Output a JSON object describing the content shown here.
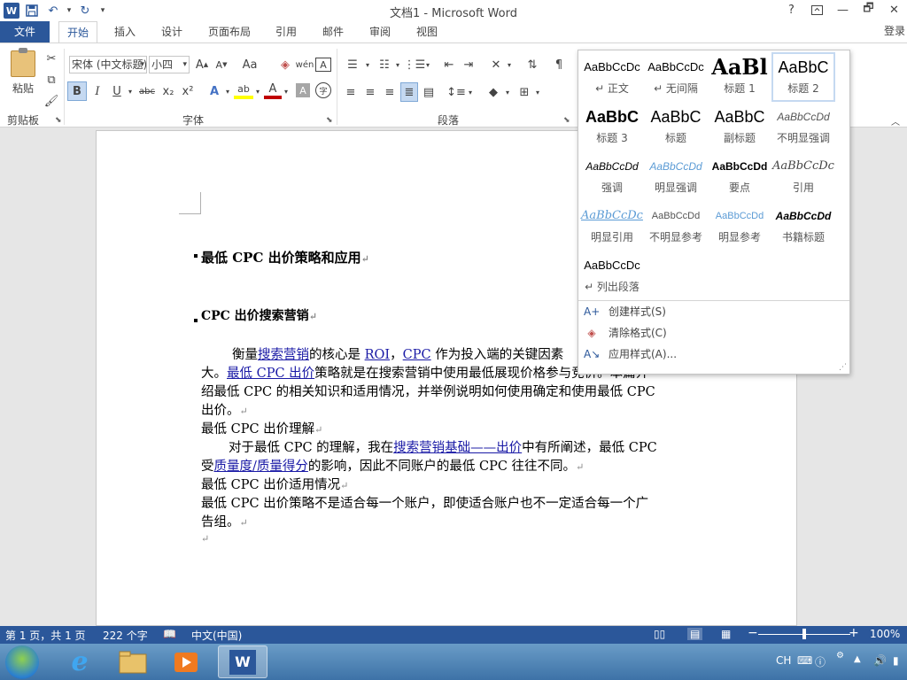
{
  "window": {
    "title": "文档1 - Microsoft Word",
    "help": "?",
    "ribbon_display_icon": "ribbon-display-options-icon",
    "minimize": "—",
    "restore": "🗗",
    "close": "✕"
  },
  "quick_access": {
    "app_icon": "W",
    "save": "💾",
    "undo": "↶",
    "undo_dropdown": "▾",
    "redo": "↻",
    "customize": "▾"
  },
  "tabs": [
    {
      "label": "文件"
    },
    {
      "label": "开始"
    },
    {
      "label": "插入"
    },
    {
      "label": "设计"
    },
    {
      "label": "页面布局"
    },
    {
      "label": "引用"
    },
    {
      "label": "邮件"
    },
    {
      "label": "审阅"
    },
    {
      "label": "视图"
    }
  ],
  "signin": "登录",
  "ribbon": {
    "clipboard": {
      "paste_label": "粘贴",
      "group_label": "剪贴板"
    },
    "font": {
      "font_name": "宋体 (中文标题)",
      "font_size": "小四",
      "grow": "A^",
      "shrink": "Aˇ",
      "change_case": "Aa",
      "clear": "✐",
      "phonetic": "wén",
      "border": "A",
      "bold": "B",
      "italic": "I",
      "underline": "U",
      "strike": "abc",
      "subscript": "x₂",
      "superscript": "x²",
      "effects": "A",
      "highlight": "ab",
      "font_color": "A",
      "shading": "A",
      "enclose": "字",
      "group_label": "字体"
    },
    "paragraph": {
      "group_label": "段落"
    }
  },
  "document": {
    "heading1": "最低 CPC 出价策略和应用",
    "heading2": "CPC 出价搜索营销",
    "p1_a": "衡量",
    "p1_link1": "搜索营销",
    "p1_b": "的核心是 ",
    "p1_link2": "ROI",
    "p1_c": "，",
    "p1_link3": "CPC",
    "p1_d": " 作为投入端的关键因素",
    "p1_line2_a": "大。",
    "p1_line2_link": "最低 CPC 出价",
    "p1_line2_b": "策略就是在搜索营销中使用最低展现价格参与竞价。本篇介",
    "p1_line3": "绍最低 CPC 的相关知识和适用情况，并举例说明如何使用确定和使用最低 CPC",
    "p1_line4": "出价。",
    "sub1": "最低 CPC 出价理解",
    "p2_a": "对于最低 CPC 的理解，我在",
    "p2_link": "搜索营销基础——出价",
    "p2_b": "中有所阐述，最低 CPC",
    "p2_line2_a": "受",
    "p2_line2_link": "质量度/质量得分",
    "p2_line2_b": "的影响，因此不同账户的最低 CPC 往往不同。",
    "sub2": "最低 CPC 出价适用情况",
    "p3_line1": "最低 CPC 出价策略不是适合每一个账户，即使适合账户也不一定适合每一个广",
    "p3_line2": "告组。",
    "para_mark": "↵"
  },
  "styles_gallery": {
    "items": [
      {
        "sample": "AaBbCcDc",
        "name": "↵ 正文"
      },
      {
        "sample": "AaBbCcDc",
        "name": "↵ 无间隔"
      },
      {
        "sample": "AaBl",
        "name": "标题 1"
      },
      {
        "sample": "AaBbC",
        "name": "标题 2"
      },
      {
        "sample": "AaBbC",
        "name": "标题 3"
      },
      {
        "sample": "AaBbC",
        "name": "标题"
      },
      {
        "sample": "AaBbC",
        "name": "副标题"
      },
      {
        "sample": "AaBbCcDd",
        "name": "不明显强调"
      },
      {
        "sample": "AaBbCcDd",
        "name": "强调"
      },
      {
        "sample": "AaBbCcDd",
        "name": "明显强调"
      },
      {
        "sample": "AaBbCcDd",
        "name": "要点"
      },
      {
        "sample": "AaBbCcDc",
        "name": "引用"
      },
      {
        "sample": "AaBbCcDc",
        "name": "明显引用"
      },
      {
        "sample": "AaBbCcDd",
        "name": "不明显参考"
      },
      {
        "sample": "AaBbCcDd",
        "name": "明显参考"
      },
      {
        "sample": "AaBbCcDd",
        "name": "书籍标题"
      },
      {
        "sample": "AaBbCcDc",
        "name": "↵ 列出段落"
      }
    ],
    "selected_index": 3,
    "commands": [
      {
        "label": "创建样式(S)",
        "icon": "create-style-icon"
      },
      {
        "label": "清除格式(C)",
        "icon": "clear-formatting-icon"
      },
      {
        "label": "应用样式(A)...",
        "icon": "apply-styles-icon"
      }
    ]
  },
  "status_bar": {
    "page": "第 1 页，共 1 页",
    "words": "222 个字",
    "language": "中文(中国)",
    "zoom_minus": "−",
    "zoom_plus": "+",
    "zoom": "100%",
    "zoom_level": 1.0
  },
  "taskbar": {
    "ime": "CH",
    "word_icon": "W",
    "ie_icon": "e"
  },
  "colors": {
    "accent": "#2b579a",
    "link": "#1a1aa6",
    "heading_sample": "#2b579a"
  }
}
